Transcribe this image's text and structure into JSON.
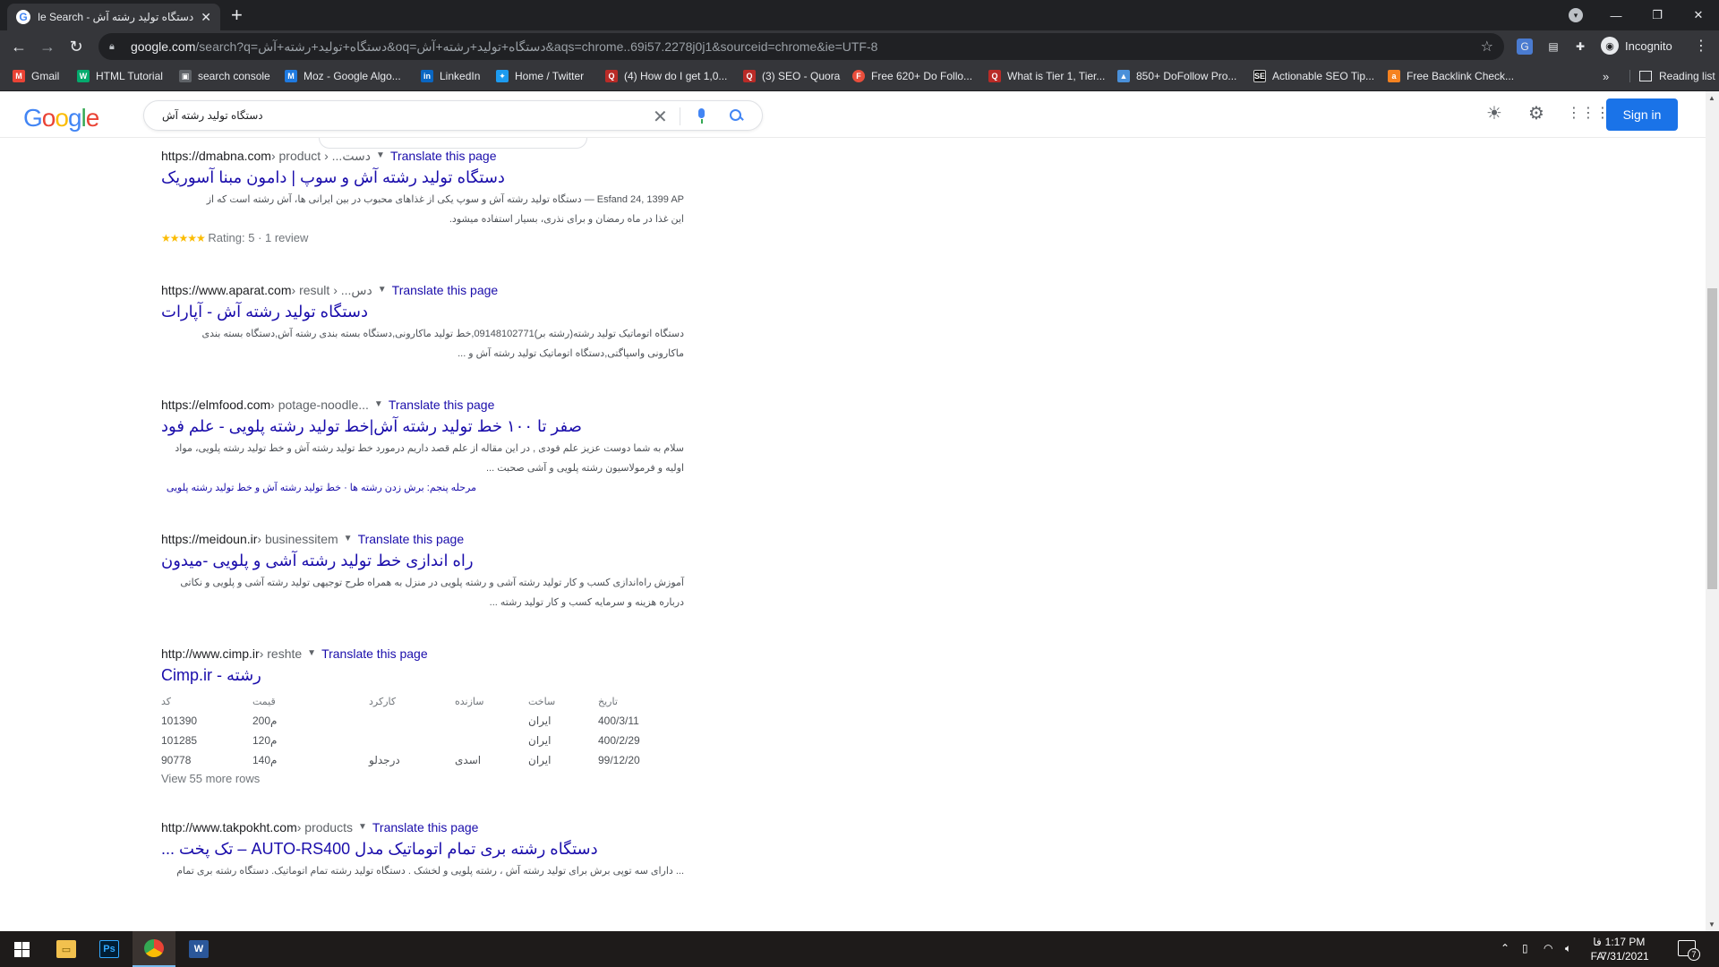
{
  "browser": {
    "tab_title": "دستگاه تولید رشته آش - Google Search",
    "address": {
      "host": "google.com",
      "path": "/search?q=دستگاه+تولید+رشته+آش&oq=دستگاه+تولید+رشته+آش&aqs=chrome..69i57.2278j0j1&sourceid=chrome&ie=UTF-8"
    },
    "profile_label": "Incognito",
    "bookmarks": [
      {
        "label": "Gmail",
        "icon": "gmail-icon",
        "color": "#ea4335",
        "glyph": "M"
      },
      {
        "label": "HTML Tutorial",
        "icon": "w3-icon",
        "color": "#04aa6d",
        "glyph": "W"
      },
      {
        "label": "search console",
        "icon": "search-console-icon",
        "color": "#5f6368",
        "glyph": "▣"
      },
      {
        "label": "Moz - Google Algo...",
        "icon": "moz-icon",
        "color": "#1f7ae0",
        "glyph": "M"
      },
      {
        "label": "LinkedIn",
        "icon": "linkedin-icon",
        "color": "#0a66c2",
        "glyph": "in"
      },
      {
        "label": "Home / Twitter",
        "icon": "twitter-icon",
        "color": "#1d9bf0",
        "glyph": "✦"
      },
      {
        "label": "(4) How do I get 1,0...",
        "icon": "quora-icon",
        "color": "#b92b27",
        "glyph": "Q"
      },
      {
        "label": "(3) SEO - Quora",
        "icon": "quora-icon",
        "color": "#b92b27",
        "glyph": "Q"
      },
      {
        "label": "Free 620+ Do Follo...",
        "icon": "site-icon",
        "color": "#e94e3c",
        "glyph": "F"
      },
      {
        "label": "What is Tier 1, Tier...",
        "icon": "quora-icon",
        "color": "#b92b27",
        "glyph": "Q"
      },
      {
        "label": "850+ DoFollow Pro...",
        "icon": "image-icon",
        "color": "#4a90d9",
        "glyph": "▲"
      },
      {
        "label": "Actionable SEO Tip...",
        "icon": "seo-icon",
        "color": "#111111",
        "glyph": "SE"
      },
      {
        "label": "Free Backlink Check...",
        "icon": "ahrefs-icon",
        "color": "#f58220",
        "glyph": "a"
      }
    ],
    "bookmarks_more": "»",
    "reading_list_label": "Reading list"
  },
  "google": {
    "logo": [
      "G",
      "o",
      "o",
      "g",
      "l",
      "e"
    ],
    "query": "دستگاه تولید رشته آش",
    "sign_in_label": "Sign in"
  },
  "results": [
    {
      "url": "https://dmabna.com",
      "path": " › product › ...دست",
      "translate": "Translate this page",
      "title": "دستگاه تولید رشته آش و سوپ | دامون مبنا آسوریک",
      "snippet_lines": [
        "Esfand 24, 1399 AP — دستگاه تولید رشته آش و سوپ یکی از غذاهای محبوب در بین ایرانی ها، آش رشته است که از",
        "این غذا در ماه رمضان و برای نذری، بسیار استفاده میشود."
      ],
      "rating_stars": "★★★★★",
      "rating_text": "Rating: 5 · 1 review"
    },
    {
      "url": "https://www.aparat.com",
      "path": " › result › ...دس",
      "translate": "Translate this page",
      "title": "دستگاه تولید رشته آش - آپارات",
      "snippet_lines": [
        "دستگاه اتوماتیک تولید رشته(رشته بر)09148102771,خط تولید ماکارونی,دستگاه بسته بندی رشته آش,دستگاه بسته بندی",
        "ماکارونی واسپاگتی,دستگاه اتوماتیک تولید رشته آش و ..."
      ]
    },
    {
      "url": "https://elmfood.com",
      "path": " › potage-noodle...",
      "translate": "Translate this page",
      "title": "صفر تا ۱۰۰ خط تولید رشته آش|خط تولید رشته پلویی - علم فود",
      "snippet_lines": [
        "سلام به شما دوست عزیز علم فودی , در این مقاله از علم قصد داریم درمورد خط تولید رشته آش و خط تولید رشته پلویی، مواد",
        "اولیه و فرمولاسیون رشته پلویی و آشی صحبت ..."
      ],
      "sitelinks": "مرحله پنجم: برش زدن رشته ها · خط تولید رشته آش و خط تولید رشته پلویی"
    },
    {
      "url": "https://meidoun.ir",
      "path": " › businessitem",
      "translate": "Translate this page",
      "title": "راه اندازی خط تولید رشته آشی و پلویی -میدون",
      "snippet_lines": [
        "آموزش راه‌اندازی کسب و کار تولید رشته آشی و رشته پلویی در منزل به همراه طرح توجیهی تولید رشته آشی و پلویی و نکاتی",
        "درباره هزینه و سرمایه کسب و کار تولید رشته ..."
      ]
    },
    {
      "url": "http://www.cimp.ir",
      "path": " › reshte",
      "translate": "Translate this page",
      "title": "رشته - Cimp.ir",
      "table": {
        "headers": [
          "کد",
          "قیمت",
          "کارکرد",
          "سازنده",
          "ساخت",
          "تاریخ"
        ],
        "rows": [
          [
            "101390",
            "200م",
            "",
            "",
            "ایران",
            "400/3/11"
          ],
          [
            "101285",
            "120م",
            "",
            "",
            "ایران",
            "400/2/29"
          ],
          [
            "90778",
            "140م",
            "درجدلو",
            "اسدی",
            "ایران",
            "99/12/20"
          ]
        ],
        "more": "View 55 more rows"
      }
    },
    {
      "url": "http://www.takpokht.com",
      "path": " › products",
      "translate": "Translate this page",
      "title": "دستگاه رشته بری تمام اتوماتیک مدل AUTO-RS400 – تک پخت ...",
      "snippet_lines": [
        "... دارای سه توپی برش برای تولید رشته آش ، رشته پلویی و لخشک . دستگاه تولید رشته تمام اتوماتیک. دستگاه رشته بری تمام"
      ]
    }
  ],
  "taskbar": {
    "lang": "فا",
    "lang_sub": "FA",
    "time": "1:17 PM",
    "date": "7/31/2021",
    "notifications": "7"
  }
}
